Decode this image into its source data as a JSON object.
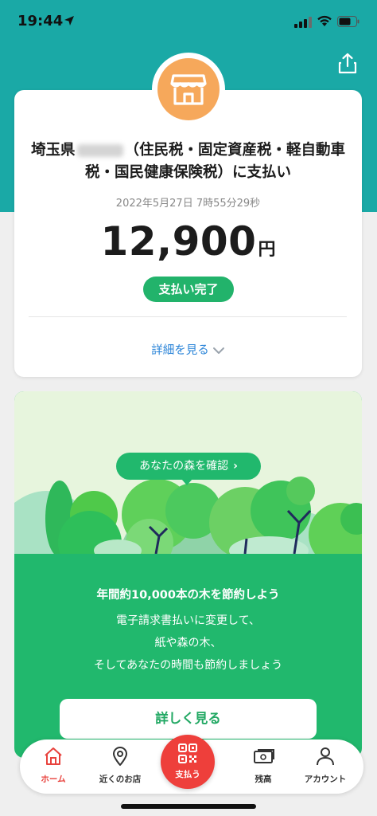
{
  "status_bar": {
    "time": "19:44",
    "icons": [
      "location-arrow-icon",
      "signal-icon",
      "wifi-icon",
      "battery-icon"
    ]
  },
  "header": {
    "share_icon": "share-icon",
    "background_color": "#1aa9a6"
  },
  "payment": {
    "merchant_icon": "store-icon",
    "merchant_prefix": "埼玉県",
    "merchant_suffix": "（住民税・固定資産税・軽自動車税・国民健康保険税）に支払い",
    "datetime": "2022年5月27日 7時55分29秒",
    "amount": "12,900",
    "currency": "円",
    "status": "支払い完了",
    "details_link": "詳細を見る"
  },
  "forest": {
    "bubble": "あなたの森を確認",
    "headline": "年間約10,000本の木を節約しよう",
    "body_lines": [
      "電子請求書払いに変更して、",
      "紙や森の木、",
      "そしてあなたの時間も節約しましょう"
    ],
    "button": "詳しく見る"
  },
  "tab_bar": {
    "items": [
      {
        "label": "ホーム",
        "icon": "home-icon",
        "active": true
      },
      {
        "label": "近くのお店",
        "icon": "map-pin-icon",
        "active": false
      },
      {
        "label": "支払う",
        "icon": "qr-code-icon",
        "active": false
      },
      {
        "label": "残高",
        "icon": "wallet-icon",
        "active": false
      },
      {
        "label": "アカウント",
        "icon": "person-icon",
        "active": false
      }
    ]
  },
  "colors": {
    "accent_green": "#21b86d",
    "pay_red": "#ee3f3b",
    "link_blue": "#2a84d8",
    "store_orange": "#f6a85b"
  }
}
